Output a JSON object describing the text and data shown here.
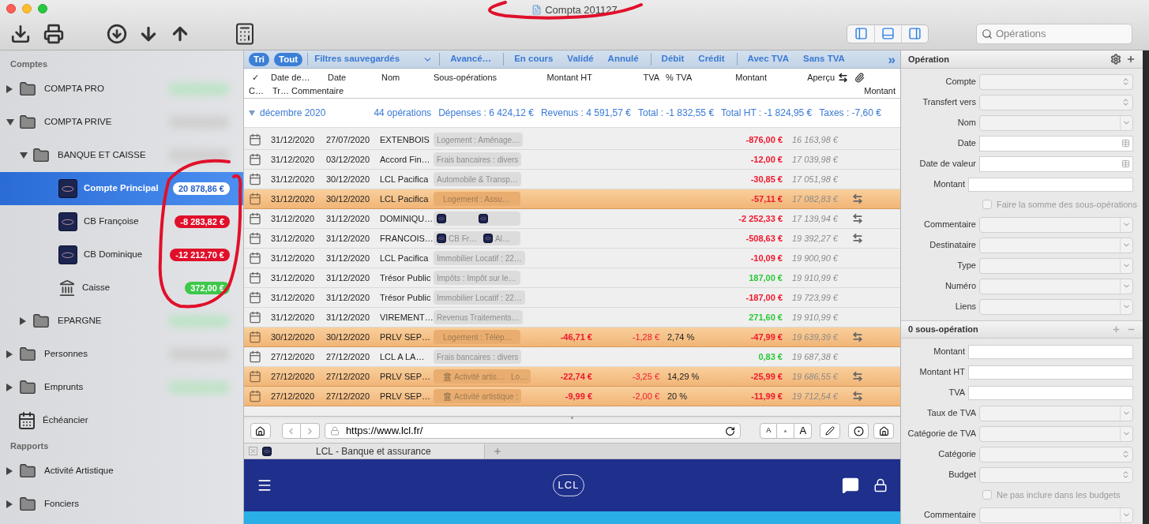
{
  "window": {
    "title": "Compta 201127"
  },
  "toolbar": {
    "view_toggles": [
      {
        "kind": "left",
        "selected": true
      },
      {
        "kind": "bottom",
        "selected": true
      },
      {
        "kind": "right",
        "selected": true
      }
    ],
    "search": {
      "placeholder": "Opérations"
    }
  },
  "sidebar": {
    "sections": [
      {
        "title": "Comptes",
        "items": [
          {
            "label": "COMPTA PRO",
            "kind": "folder",
            "expanded": false,
            "selected": false,
            "balance": {
              "kind": "blurred",
              "color": "#bfe3c8"
            }
          },
          {
            "label": "COMPTA PRIVE",
            "kind": "folder",
            "expanded": true,
            "selected": false,
            "balance": {
              "kind": "blurred",
              "color": "#d0d0d0"
            },
            "children": [
              {
                "label": "BANQUE ET CAISSE",
                "kind": "folder",
                "expanded": true,
                "selected": false,
                "balance": {
                  "kind": "blurred",
                  "color": "#d0d0d0"
                },
                "children": [
                  {
                    "label": "Compte Principal",
                    "kind": "bank-card",
                    "selected": true,
                    "balance": {
                      "kind": "amount",
                      "text": "20 878,86 €",
                      "color": "#ffffff"
                    }
                  },
                  {
                    "label": "CB Françoise",
                    "kind": "bank-card",
                    "selected": false,
                    "balance": {
                      "kind": "amount",
                      "text": "-8 283,82 €",
                      "color": "#e0102a"
                    }
                  },
                  {
                    "label": "CB Dominique",
                    "kind": "bank-card",
                    "selected": false,
                    "balance": {
                      "kind": "amount",
                      "text": "-12 212,70 €",
                      "color": "#e0102a"
                    }
                  },
                  {
                    "label": "Caisse",
                    "kind": "bank",
                    "selected": false,
                    "balance": {
                      "kind": "amount",
                      "text": "372,00 €",
                      "color": "#3dc84a"
                    }
                  }
                ]
              },
              {
                "label": "EPARGNE",
                "kind": "folder",
                "expanded": false,
                "selected": false,
                "balance": {
                  "kind": "blurred",
                  "color": "#bfe3c8"
                }
              }
            ]
          },
          {
            "label": "Personnes",
            "kind": "folder",
            "expanded": false,
            "selected": false,
            "balance": {
              "kind": "blurred",
              "color": "#d0d0d0"
            }
          },
          {
            "label": "Emprunts",
            "kind": "folder",
            "expanded": false,
            "selected": false,
            "balance": {
              "kind": "blurred",
              "color": "#bfe3c8"
            }
          },
          {
            "label": "Échéancier",
            "kind": "calendar",
            "selected": false
          }
        ]
      },
      {
        "title": "Rapports",
        "items": [
          {
            "label": "Activité Artistique",
            "kind": "folder",
            "expanded": false,
            "selected": false
          },
          {
            "label": "Fonciers",
            "kind": "folder",
            "expanded": false,
            "selected": false
          }
        ]
      }
    ]
  },
  "filters": [
    {
      "label": "Tri",
      "kind": "pill",
      "selected": true
    },
    {
      "label": "Tout",
      "kind": "pill",
      "selected": true
    },
    {
      "label": "Filtres sauvegardés",
      "kind": "menu",
      "selected": false
    },
    {
      "label": "Avancé…",
      "kind": "link",
      "selected": false
    },
    {
      "label": "En cours",
      "kind": "link",
      "selected": false
    },
    {
      "label": "Validé",
      "kind": "link",
      "selected": false
    },
    {
      "label": "Annulé",
      "kind": "link",
      "selected": false
    },
    {
      "label": "Débit",
      "kind": "link",
      "selected": false
    },
    {
      "label": "Crédit",
      "kind": "link",
      "selected": false
    },
    {
      "label": "Avec TVA",
      "kind": "link",
      "selected": false
    },
    {
      "label": "Sans TVA",
      "kind": "link",
      "selected": false
    },
    {
      "label": "»",
      "kind": "more",
      "selected": false
    }
  ],
  "columns_row_1": [
    "✓",
    "Date de…",
    "Date",
    "Nom",
    "Sous-opérations",
    "Montant HT",
    "TVA",
    "% TVA",
    "Montant",
    "Aperçu"
  ],
  "columns_row_2": [
    "C…",
    "Tr…",
    "Commentaire",
    "Montant"
  ],
  "group": {
    "title": "décembre 2020",
    "expanded": true,
    "count": "44 opérations",
    "stats": [
      "Dépenses : 6 424,12 €",
      "Revenus : 4 591,57 €",
      "Total : -1 832,55 €",
      "Total HT : -1 824,95 €",
      "Taxes : -7,60 €"
    ]
  },
  "rows": [
    {
      "kind": "debit",
      "date": "31/12/2020",
      "value_date": "27/07/2020",
      "name": "EXTENBOIS",
      "sub": [
        {
          "kind": "text",
          "text": "Logement : Aménage…"
        }
      ],
      "amount": "-876,00 €",
      "balance": "16 163,98 €",
      "highlighted": false,
      "transfer": false
    },
    {
      "kind": "debit",
      "date": "31/12/2020",
      "value_date": "03/12/2020",
      "name": "Accord Fin…",
      "sub": [
        {
          "kind": "text",
          "text": "Frais bancaires : divers"
        }
      ],
      "amount": "-12,00 €",
      "balance": "17 039,98 €",
      "highlighted": false,
      "transfer": false
    },
    {
      "kind": "debit",
      "date": "31/12/2020",
      "value_date": "30/12/2020",
      "name": "LCL Pacifica",
      "sub": [
        {
          "kind": "text",
          "text": "Automobile & Transp…"
        }
      ],
      "amount": "-30,85 €",
      "balance": "17 051,98 €",
      "highlighted": false,
      "transfer": false
    },
    {
      "kind": "debit",
      "date": "31/12/2020",
      "value_date": "30/12/2020",
      "name": "LCL Pacifica",
      "sub": [
        {
          "kind": "text",
          "text": "Logement : Assu…"
        }
      ],
      "amount": "-57,11 €",
      "balance": "17 082,83 €",
      "highlighted": true,
      "transfer": true
    },
    {
      "kind": "debit",
      "date": "31/12/2020",
      "value_date": "31/12/2020",
      "name": "DOMINIQU…",
      "sub": [
        {
          "kind": "bank-card"
        },
        {
          "kind": "bank-card"
        }
      ],
      "amount": "-2 252,33 €",
      "balance": "17 139,94 €",
      "highlighted": false,
      "transfer": true
    },
    {
      "kind": "debit",
      "date": "31/12/2020",
      "value_date": "31/12/2020",
      "name": "FRANCOIS…",
      "sub": [
        {
          "kind": "bank-card",
          "text": "CB Fr…"
        },
        {
          "kind": "bank-card",
          "text": "Al…"
        }
      ],
      "amount": "-508,63 €",
      "balance": "19 392,27 €",
      "highlighted": false,
      "transfer": true
    },
    {
      "kind": "debit",
      "date": "31/12/2020",
      "value_date": "31/12/2020",
      "name": "LCL Pacifica",
      "sub": [
        {
          "kind": "text",
          "text": "Immobilier Locatif : 22…"
        }
      ],
      "amount": "-10,09 €",
      "balance": "19 900,90 €",
      "highlighted": false,
      "transfer": false
    },
    {
      "kind": "credit",
      "date": "31/12/2020",
      "value_date": "31/12/2020",
      "name": "Trésor Public",
      "sub": [
        {
          "kind": "text",
          "text": "Impôts : Impôt sur le…"
        }
      ],
      "amount": "187,00 €",
      "balance": "19 910,99 €",
      "highlighted": false,
      "transfer": false
    },
    {
      "kind": "debit",
      "date": "31/12/2020",
      "value_date": "31/12/2020",
      "name": "Trésor Public",
      "sub": [
        {
          "kind": "text",
          "text": "Immobilier Locatif : 22…"
        }
      ],
      "amount": "-187,00 €",
      "balance": "19 723,99 €",
      "highlighted": false,
      "transfer": false
    },
    {
      "kind": "credit",
      "date": "31/12/2020",
      "value_date": "31/12/2020",
      "name": "VIREMENT…",
      "sub": [
        {
          "kind": "text",
          "text": "Revenus Traitements…"
        }
      ],
      "amount": "271,60 €",
      "balance": "19 910,99 €",
      "highlighted": false,
      "transfer": false
    },
    {
      "kind": "debit",
      "date": "30/12/2020",
      "value_date": "30/12/2020",
      "name": "PRLV SEP…",
      "sub": [
        {
          "kind": "text",
          "text": "Logement : Télép…"
        }
      ],
      "amount_ht": "-46,71 €",
      "tva": "-1,28 €",
      "tva_rate": "2,74 %",
      "amount": "-47,99 €",
      "balance": "19 639,39 €",
      "highlighted": true,
      "transfer": true
    },
    {
      "kind": "credit",
      "date": "27/12/2020",
      "value_date": "27/12/2020",
      "name": "LCL A LA…",
      "sub": [
        {
          "kind": "text",
          "text": "Frais bancaires : divers"
        }
      ],
      "amount": "0,83 €",
      "balance": "19 687,38 €",
      "highlighted": false,
      "transfer": false
    },
    {
      "kind": "debit",
      "date": "27/12/2020",
      "value_date": "27/12/2020",
      "name": "PRLV SEP…",
      "sub": [
        {
          "kind": "bank",
          "text": "Activité artis…"
        },
        {
          "kind": "text",
          "text": "Lo…"
        }
      ],
      "amount_ht": "-22,74 €",
      "tva": "-3,25 €",
      "tva_rate": "14,29 %",
      "amount": "-25,99 €",
      "balance": "19 686,55 €",
      "highlighted": true,
      "transfer": true
    },
    {
      "kind": "debit",
      "date": "27/12/2020",
      "value_date": "27/12/2020",
      "name": "PRLV SEP…",
      "sub": [
        {
          "kind": "bank",
          "text": "Activité artistique :"
        }
      ],
      "amount_ht": "-9,99 €",
      "tva": "-2,00 €",
      "tva_rate": "20 %",
      "amount": "-11,99 €",
      "balance": "19 712,54 €",
      "highlighted": true,
      "transfer": true
    }
  ],
  "browser": {
    "url": "https://www.lcl.fr/",
    "text_size_buttons": [
      "A",
      "A"
    ],
    "tab": "LCL - Banque et assurance",
    "logo": "LCL"
  },
  "inspector": {
    "sections": [
      {
        "title": "Opération",
        "kind": "operation",
        "fields": [
          {
            "label": "Compte",
            "kind": "stepper"
          },
          {
            "label": "Transfert vers",
            "kind": "stepper"
          },
          {
            "label": "Nom",
            "kind": "combo"
          },
          {
            "label": "Date",
            "kind": "date"
          },
          {
            "label": "Date de valeur",
            "kind": "date"
          },
          {
            "label": "Montant",
            "kind": "text"
          },
          {
            "label": "Faire la somme des sous-opérations",
            "kind": "checkbox",
            "checked": false
          },
          {
            "label": "Commentaire",
            "kind": "combo"
          },
          {
            "label": "Destinataire",
            "kind": "combo"
          },
          {
            "label": "Type",
            "kind": "combo"
          },
          {
            "label": "Numéro",
            "kind": "combo"
          },
          {
            "label": "Liens",
            "kind": "combo"
          }
        ]
      },
      {
        "title": "0 sous-opération",
        "kind": "sub-operations",
        "fields": [
          {
            "label": "Montant",
            "kind": "text"
          },
          {
            "label": "Montant HT",
            "kind": "text"
          },
          {
            "label": "TVA",
            "kind": "text"
          },
          {
            "label": "Taux de TVA",
            "kind": "combo"
          },
          {
            "label": "Catégorie de TVA",
            "kind": "combo"
          },
          {
            "label": "Catégorie",
            "kind": "stepper"
          },
          {
            "label": "Budget",
            "kind": "stepper"
          },
          {
            "label": "Ne pas inclure dans les budgets",
            "kind": "checkbox",
            "checked": false
          },
          {
            "label": "Commentaire",
            "kind": "combo"
          }
        ]
      }
    ]
  }
}
